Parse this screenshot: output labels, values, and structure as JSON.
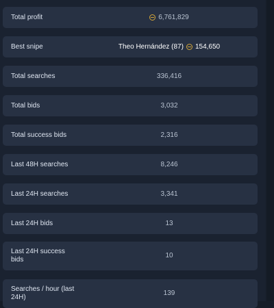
{
  "stats": [
    {
      "label": "Total profit",
      "value": "6,761,829",
      "has_coin": true
    },
    {
      "label": "Best snipe",
      "player": "Theo Hernández (87)",
      "value": "154,650",
      "has_coin": true
    },
    {
      "label": "Total searches",
      "value": "336,416"
    },
    {
      "label": "Total bids",
      "value": "3,032"
    },
    {
      "label": "Total success bids",
      "value": "2,316"
    },
    {
      "label": "Last 48H searches",
      "value": "8,246"
    },
    {
      "label": "Last 24H searches",
      "value": "3,341"
    },
    {
      "label": "Last 24H bids",
      "value": "13"
    },
    {
      "label": "Last 24H success bids",
      "value": "10"
    },
    {
      "label": "Searches / hour (last 24H)",
      "value": "139"
    }
  ],
  "colors": {
    "background": "#1a2230",
    "row": "#273143",
    "coin": "#d4a63a"
  },
  "icons": {
    "coin": "coin-icon"
  }
}
